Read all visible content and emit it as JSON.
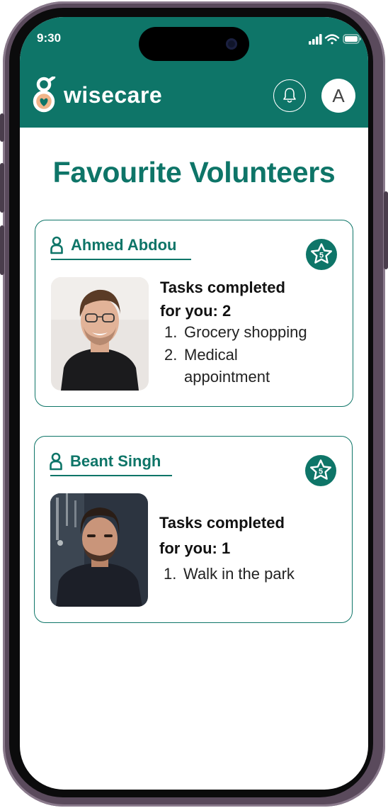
{
  "status_bar": {
    "time": "9:30"
  },
  "app": {
    "name": "wisecare"
  },
  "header": {
    "avatar_initial": "A"
  },
  "page": {
    "title": "Favourite Volunteers"
  },
  "volunteers": [
    {
      "name": "Ahmed Abdou",
      "badge": "5",
      "tasks_line1": "Tasks completed",
      "tasks_line2": "for you: 2",
      "tasks": [
        {
          "num": "1.",
          "text": "Grocery shopping"
        },
        {
          "num": "2.",
          "text": "Medical appointment"
        }
      ]
    },
    {
      "name": "Beant Singh",
      "badge": "5",
      "tasks_line1": "Tasks completed",
      "tasks_line2": "for you: 1",
      "tasks": [
        {
          "num": "1.",
          "text": "Walk in the park"
        }
      ]
    }
  ],
  "colors": {
    "primary": "#0e7568",
    "logo_accent": "#f0b58a",
    "text": "#111111"
  },
  "icons": [
    "wifi-icon",
    "signal-icon",
    "battery-icon",
    "bell-icon",
    "person-icon",
    "star-badge-icon"
  ]
}
